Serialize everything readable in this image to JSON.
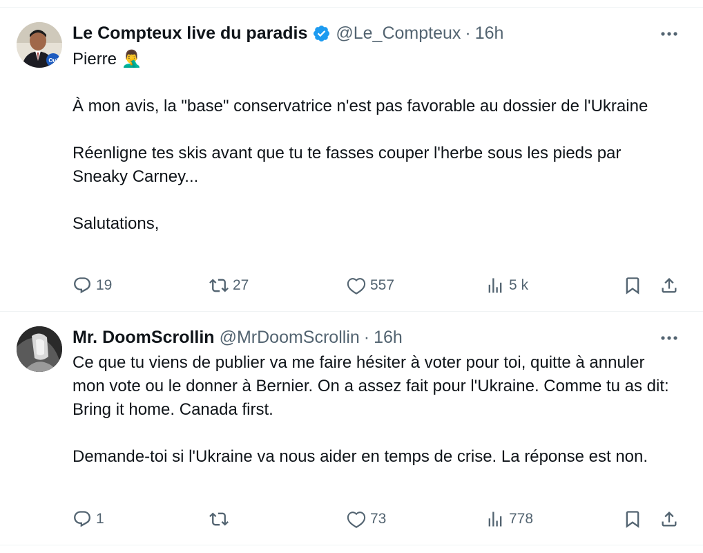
{
  "tweets": [
    {
      "name": "Le Compteux live du paradis",
      "verified": true,
      "handle": "@Le_Compteux",
      "separator": "·",
      "time": "16h",
      "avatar_badge": "Oui",
      "body": [
        "Pierre 🤦‍♂️",
        "À mon avis, la \"base\" conservatrice n'est pas favorable au dossier de l'Ukraine",
        "Réenligne tes skis avant que tu te fasses couper l'herbe sous les pieds par Sneaky Carney...",
        "Salutations,"
      ],
      "actions": {
        "replies": "19",
        "reposts": "27",
        "likes": "557",
        "views": "5 k"
      }
    },
    {
      "name": "Mr. DoomScrollin",
      "verified": false,
      "handle": "@MrDoomScrollin",
      "separator": "·",
      "time": "16h",
      "body": [
        "Ce que tu viens de publier va me faire hésiter à voter pour toi, quitte à annuler mon vote ou le donner à Bernier. On a assez fait pour l'Ukraine. Comme tu as dit: Bring it home. Canada first.",
        "Demande-toi si l'Ukraine va nous aider en temps de crise. La réponse est non."
      ],
      "actions": {
        "replies": "1",
        "reposts": "",
        "likes": "73",
        "views": "778"
      }
    }
  ],
  "colors": {
    "text": "#0f1419",
    "secondary": "#536471",
    "verified": "#1d9bf0",
    "border": "#eff3f4"
  },
  "icons": {
    "reply": "reply-icon",
    "repost": "repost-icon",
    "like": "heart-icon",
    "views": "views-icon",
    "bookmark": "bookmark-icon",
    "share": "share-icon",
    "more": "more-icon",
    "verified": "verified-badge-icon"
  }
}
